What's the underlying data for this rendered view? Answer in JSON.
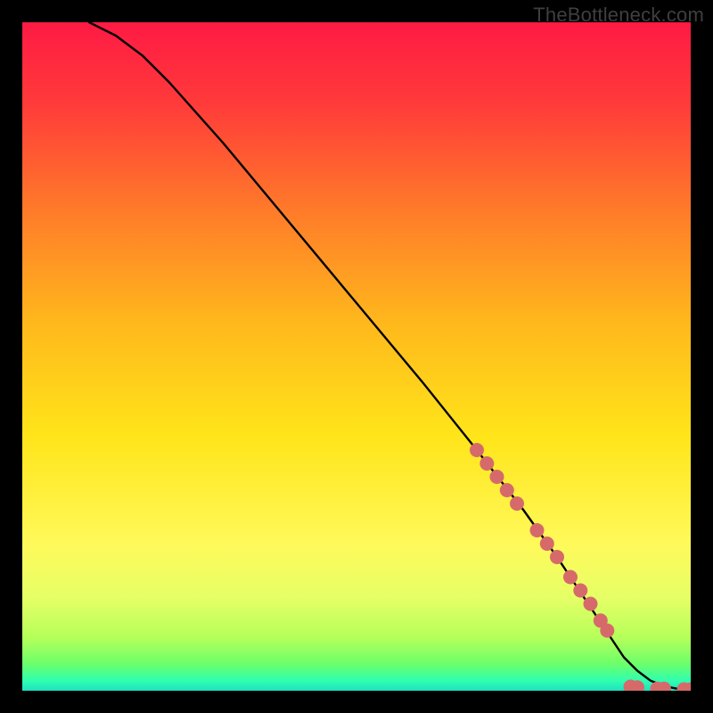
{
  "watermark": "TheBottleneck.com",
  "gradient_stops": [
    {
      "offset": 0.0,
      "color": "#ff1a44"
    },
    {
      "offset": 0.12,
      "color": "#ff3a3a"
    },
    {
      "offset": 0.28,
      "color": "#ff7a2a"
    },
    {
      "offset": 0.45,
      "color": "#ffb81c"
    },
    {
      "offset": 0.62,
      "color": "#ffe51a"
    },
    {
      "offset": 0.78,
      "color": "#fff95a"
    },
    {
      "offset": 0.86,
      "color": "#e6ff66"
    },
    {
      "offset": 0.92,
      "color": "#b6ff5a"
    },
    {
      "offset": 0.96,
      "color": "#6cff6a"
    },
    {
      "offset": 0.985,
      "color": "#2fffb0"
    },
    {
      "offset": 1.0,
      "color": "#20e0c0"
    }
  ],
  "chart_data": {
    "type": "line",
    "title": "",
    "xlabel": "",
    "ylabel": "",
    "xlim": [
      0,
      100
    ],
    "ylim": [
      0,
      100
    ],
    "series": [
      {
        "name": "main-curve",
        "x": [
          10,
          14,
          18,
          22,
          30,
          40,
          50,
          60,
          68,
          75,
          80,
          84,
          88,
          90,
          92,
          94,
          96,
          98,
          100
        ],
        "y": [
          100,
          98,
          95,
          91,
          82,
          70,
          58,
          46,
          36,
          27,
          20,
          14,
          8,
          5,
          3,
          1.5,
          0.7,
          0.3,
          0.2
        ]
      }
    ],
    "scatter": {
      "name": "highlight-dots",
      "color": "#d66a6a",
      "radius": 8,
      "points": [
        {
          "x": 68,
          "y": 36
        },
        {
          "x": 69.5,
          "y": 34
        },
        {
          "x": 71,
          "y": 32
        },
        {
          "x": 72.5,
          "y": 30
        },
        {
          "x": 74,
          "y": 28
        },
        {
          "x": 77,
          "y": 24
        },
        {
          "x": 78.5,
          "y": 22
        },
        {
          "x": 80,
          "y": 20
        },
        {
          "x": 82,
          "y": 17
        },
        {
          "x": 83.5,
          "y": 15
        },
        {
          "x": 85,
          "y": 13
        },
        {
          "x": 86.5,
          "y": 10.5
        },
        {
          "x": 87.5,
          "y": 9
        },
        {
          "x": 91,
          "y": 0.6
        },
        {
          "x": 92,
          "y": 0.5
        },
        {
          "x": 95,
          "y": 0.3
        },
        {
          "x": 96,
          "y": 0.3
        },
        {
          "x": 99,
          "y": 0.2
        },
        {
          "x": 100,
          "y": 0.2
        }
      ]
    }
  }
}
